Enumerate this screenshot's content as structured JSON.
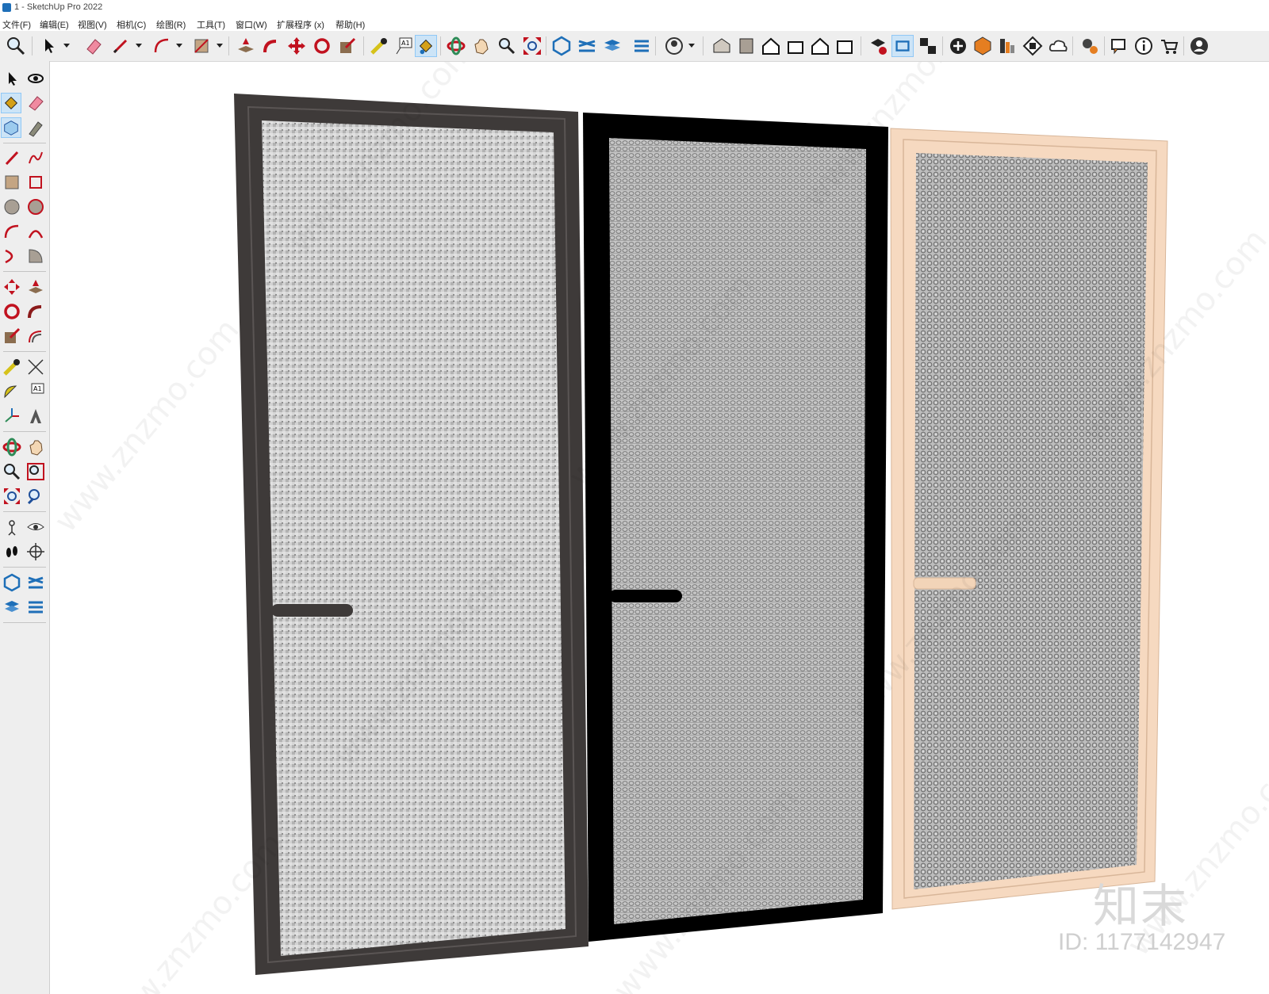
{
  "window": {
    "title": "1 - SketchUp Pro 2022"
  },
  "menu": [
    {
      "label": "文件(F)"
    },
    {
      "label": "编辑(E)"
    },
    {
      "label": "视图(V)"
    },
    {
      "label": "相机(C)"
    },
    {
      "label": "绘图(R)"
    },
    {
      "label": "工具(T)"
    },
    {
      "label": "窗口(W)"
    },
    {
      "label": "扩展程序 (x)"
    },
    {
      "label": "帮助(H)"
    }
  ],
  "toolbar_icons": [
    "zoom-icon",
    "select-icon",
    "eraser-icon",
    "pencil-icon",
    "arc-icon",
    "rectangle-icon",
    "push-pull-icon",
    "follow-me-icon",
    "move-icon",
    "rotate-icon",
    "scale-icon",
    "tape-measure-icon",
    "text-icon",
    "paint-bucket-icon",
    "orbit-icon",
    "pan-icon",
    "zoom-window-icon",
    "zoom-extents-icon",
    "solid-tools-icon",
    "sandbox-icon",
    "layers-icon",
    "components-icon",
    "account-icon",
    "iso-view-icon",
    "top-view-icon",
    "front-view-icon",
    "right-view-icon",
    "back-view-icon",
    "left-view-icon",
    "styles-icon",
    "shadows-icon",
    "section-icon",
    "add-location-icon",
    "terrain-icon",
    "photo-texture-icon",
    "checker-icon",
    "cloud-icon",
    "extension-manager-icon",
    "chat-icon",
    "info-icon",
    "cart-icon",
    "user-icon"
  ],
  "left_tools": [
    "select-icon",
    "orbit-icon",
    "paint-bucket-icon",
    "eraser-icon",
    "component-icon",
    "tag-icon",
    "pencil-icon",
    "freehand-icon",
    "rectangle-icon",
    "rotated-rectangle-icon",
    "circle-icon",
    "polygon-icon",
    "arc-icon",
    "two-point-arc-icon",
    "three-point-arc-icon",
    "pie-icon",
    "move-icon",
    "push-pull-icon",
    "rotate-icon",
    "follow-me-icon",
    "scale-icon",
    "offset-icon",
    "tape-measure-icon",
    "dimension-icon",
    "protractor-icon",
    "text-icon",
    "axes-icon",
    "3d-text-icon",
    "orbit-tool-icon",
    "pan-tool-icon",
    "zoom-tool-icon",
    "zoom-window-tool-icon",
    "zoom-extents-tool-icon",
    "previous-view-icon",
    "position-camera-icon",
    "look-around-icon",
    "walk-icon",
    "section-plane-icon",
    "solid-tools-icon",
    "sandbox-icon",
    "layers-icon",
    "components-icon"
  ],
  "doors": [
    {
      "frame_color": "#3e3a39",
      "handle_color": "#3e3a39",
      "mesh_fill": "#cfcfcf",
      "name": "dark-brown-frame"
    },
    {
      "frame_color": "#000000",
      "handle_color": "#000000",
      "mesh_fill": "#bdbdbd",
      "name": "black-frame"
    },
    {
      "frame_color": "#f6d9c0",
      "handle_color": "#f2d4b8",
      "mesh_fill": "#b4b4b4",
      "name": "champagne-frame"
    }
  ],
  "watermark": {
    "url": "www.znzmo.com",
    "logo": "知末",
    "id": "ID: 1177142947"
  }
}
